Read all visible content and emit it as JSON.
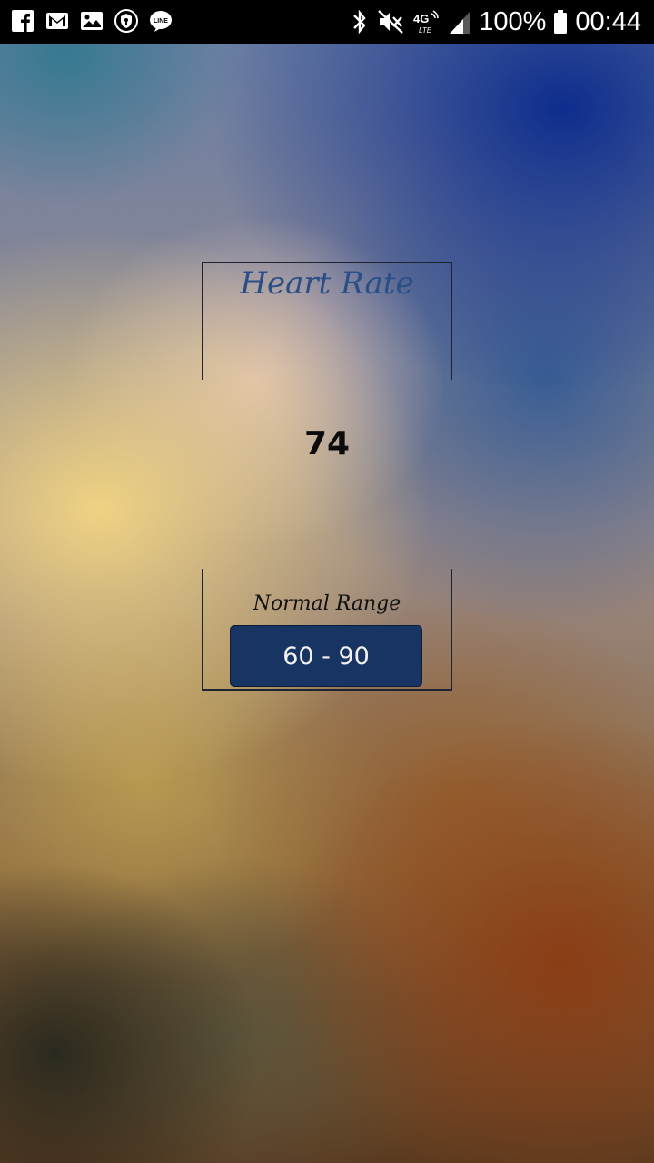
{
  "status_bar": {
    "left_icons": [
      "facebook-icon",
      "gmail-icon",
      "gallery-icon",
      "vpn-shield-icon",
      "line-icon"
    ],
    "right_icons": [
      "bluetooth-icon",
      "mute-icon",
      "4g-lte-icon",
      "signal-icon",
      "battery-icon"
    ],
    "network_label": "4G",
    "battery": "100%",
    "time": "00:44"
  },
  "card": {
    "title": "Heart Rate",
    "value": "74",
    "range_label": "Normal Range",
    "range_value": "60 - 90"
  },
  "colors": {
    "title": "#2a4f86",
    "button_bg": "#173463",
    "status_bar_bg": "#000000"
  }
}
